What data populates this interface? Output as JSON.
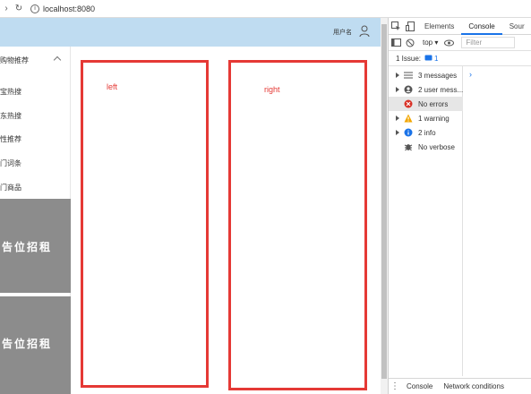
{
  "browser": {
    "url": "localhost:8080",
    "back_glyph": "›",
    "reload_glyph": "↻"
  },
  "header": {
    "username": "用户名"
  },
  "sidebar": {
    "group_label": "购物推荐",
    "items": [
      {
        "label": "宝热搜"
      },
      {
        "label": "东热搜"
      },
      {
        "label": "性推荐"
      },
      {
        "label": "门词条"
      },
      {
        "label": "门商品"
      }
    ],
    "ads": [
      {
        "text": "广告位招租"
      },
      {
        "text": "广告位招租"
      }
    ]
  },
  "panels": {
    "left_label": "left",
    "right_label": "right"
  },
  "devtools": {
    "tabs": [
      "Elements",
      "Console",
      "Sour"
    ],
    "active_tab": "Console",
    "context": "top",
    "filter_placeholder": "Filter",
    "issues_text": "1 Issue:",
    "issues_count": "1",
    "sidebar": [
      {
        "label": "3 messages",
        "icon": "list-icon"
      },
      {
        "label": "2 user mess...",
        "icon": "user-icon"
      },
      {
        "label": "No errors",
        "icon": "error-icon"
      },
      {
        "label": "1 warning",
        "icon": "warning-icon"
      },
      {
        "label": "2 info",
        "icon": "info-icon"
      },
      {
        "label": "No verbose",
        "icon": "bug-icon"
      }
    ],
    "prompt_glyph": "›",
    "drawer_tabs": [
      "Console",
      "Network conditions"
    ]
  },
  "colors": {
    "header_bg": "#bfdcf1",
    "panel_border": "#e53935",
    "ad_bg": "#8c8c8c",
    "accent": "#1a73e8"
  }
}
